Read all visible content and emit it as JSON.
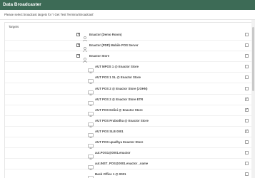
{
  "window": {
    "title": "Data Broadcaster"
  },
  "instruction": "Please select broadcast targets for 'I Get Test Terminal Broadcast'",
  "targets_panel": {
    "label": "Targets"
  },
  "tree": [
    {
      "label": "Enactor (Demo Room)",
      "level": 0,
      "expander": "+",
      "icon": "user",
      "checked": false
    },
    {
      "label": "Enactor (PDP) Mobile POS Server",
      "level": 0,
      "expander": "+",
      "icon": "user",
      "checked": false
    },
    {
      "label": "Enactor Store",
      "level": 0,
      "expander": "−",
      "icon": "user",
      "checked": false
    },
    {
      "label": "AUT MPOS 1 @ Enactor Store",
      "level": 1,
      "icon": "monitor",
      "checked": false
    },
    {
      "label": "AUT POS 1 SL @ Enactor Store",
      "level": 1,
      "icon": "monitor",
      "checked": false
    },
    {
      "label": "AUT POS 2 @ Enactor Store (JOHN)",
      "level": 1,
      "icon": "monitor",
      "checked": false
    },
    {
      "label": "AUT POS 2 @ Enactor Store ETR",
      "level": 1,
      "icon": "monitor",
      "checked": true
    },
    {
      "label": "AUT POS Delini @ Enactor Store",
      "level": 1,
      "icon": "monitor",
      "checked": true
    },
    {
      "label": "AUT POS Prabodha @ Enactor Store",
      "level": 1,
      "icon": "monitor",
      "checked": false
    },
    {
      "label": "AUT POS SLB 0001",
      "level": 1,
      "icon": "monitor",
      "checked": true
    },
    {
      "label": "AUT POS upadhya Enactor Store",
      "level": 1,
      "icon": "monitor",
      "checked": false
    },
    {
      "label": "aut.POS1@0001.enactor",
      "level": 1,
      "icon": "monitor",
      "checked": false
    },
    {
      "label": "aut.INST_POS@0001.enactor_.name",
      "level": 1,
      "icon": "monitor",
      "checked": false
    },
    {
      "label": "Back Office 1 @ 0001",
      "level": 1,
      "icon": "monitor",
      "checked": false
    }
  ],
  "colors": {
    "titlebar": "#3d6b56",
    "text": "#444444",
    "border": "#e6e6e6"
  }
}
